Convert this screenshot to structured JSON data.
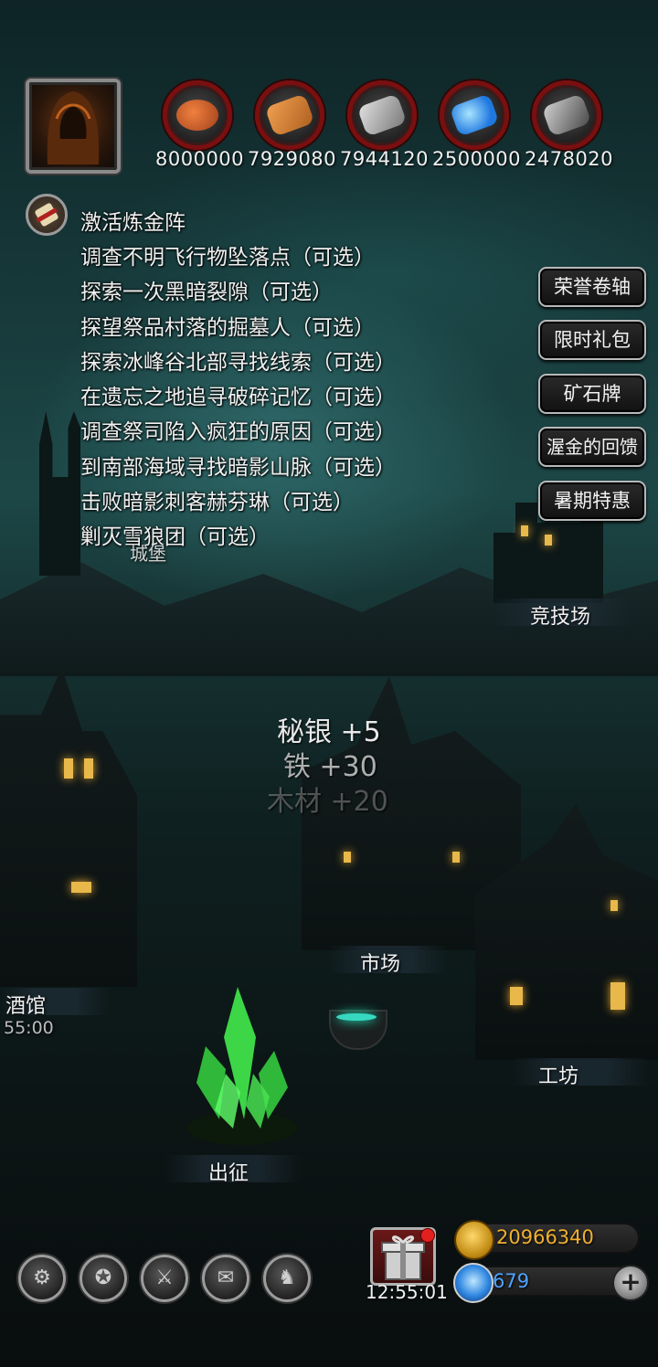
{
  "resources": [
    {
      "icon": "meat-icon",
      "value": "8000000"
    },
    {
      "icon": "wood-icon",
      "value": "7929080"
    },
    {
      "icon": "iron-icon",
      "value": "7944120"
    },
    {
      "icon": "crystal-icon",
      "value": "2500000"
    },
    {
      "icon": "mithril-icon",
      "value": "2478020"
    }
  ],
  "quests": [
    "激活炼金阵",
    "调查不明飞行物坠落点（可选）",
    "探索一次黑暗裂隙（可选）",
    "探望祭品村落的掘墓人（可选）",
    "探索冰峰谷北部寻找线索（可选）",
    "在遗忘之地追寻破碎记忆（可选）",
    "调查祭司陷入疯狂的原因（可选）",
    "到南部海域寻找暗影山脉（可选）",
    "击败暗影刺客赫芬琳（可选）",
    "剿灭雪狼团（可选）"
  ],
  "side_buttons": [
    "荣誉卷轴",
    "限时礼包",
    "矿石牌",
    "渥金的回馈",
    "暑期特惠"
  ],
  "places": {
    "castle": "城堡",
    "arena": "竞技场",
    "market": "市场",
    "tavern": "酒馆",
    "tavern_timer": "55:00",
    "workshop": "工坊",
    "expedition": "出征"
  },
  "floating_gains": [
    "秘银 +5",
    "铁 +30",
    "木材 +20"
  ],
  "gift_timer": "12:55:01",
  "currency": {
    "gold": "20966340",
    "diamonds": "679"
  },
  "bottom_menu_icons": [
    "settings-icon",
    "achievement-icon",
    "guild-icon",
    "mail-icon",
    "hero-icon"
  ],
  "colors": {
    "gold_text": "#f0b030",
    "diamond_text": "#4fa3ff",
    "resource_frame": "#7a0f10"
  }
}
